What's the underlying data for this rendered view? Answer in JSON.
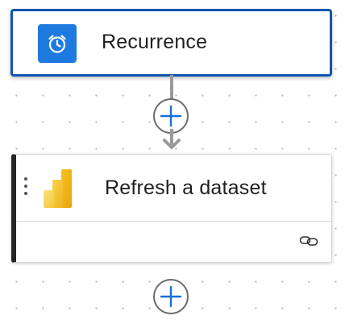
{
  "flow": {
    "trigger": {
      "title": "Recurrence",
      "icon": "alarm-clock-icon",
      "icon_color": "#1f7ae0",
      "border_color": "#1254b0"
    },
    "action": {
      "title": "Refresh a dataset",
      "icon": "power-bi-icon",
      "connection_icon": "link-icon",
      "accent_color": "#252525"
    },
    "add_step_icon": "plus-icon",
    "add_color": "#1a6fd4"
  }
}
